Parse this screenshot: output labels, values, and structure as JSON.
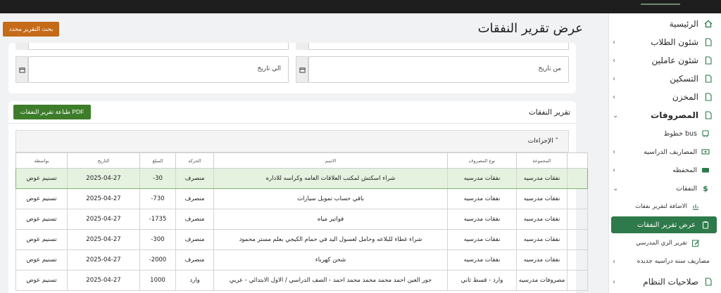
{
  "header": {
    "page_title": "عرض تقرير النفقات",
    "search_button": "بحث التقرير محدد"
  },
  "filters": {
    "from_date_label": "من تاريخ",
    "to_date_label": "الي تاريخ"
  },
  "report": {
    "title": "تقرير النفقات",
    "print_button": "طباعة تقرير النفقات PDF",
    "actions_label": "الإجراءات ˅"
  },
  "table": {
    "headers": [
      "بواسطه",
      "التاريخ",
      "المبلغ",
      "الحركه",
      "الاسم",
      "نوع المصروف",
      "المجموعة",
      ""
    ],
    "rows": [
      [
        "تسنيم عوض",
        "2025-04-27",
        "-30",
        "منصرف",
        "شراء اسكتش لمكتب العلاقات العامه وكراسه للاداره",
        "نفقات مدرسيه",
        "نفقات مدرسيه",
        ""
      ],
      [
        "تسنيم عوض",
        "2025-04-27",
        "-730",
        "منصرف",
        "باقي حساب تمويل سيارات",
        "نفقات مدرسيه",
        "نفقات مدرسيه",
        ""
      ],
      [
        "تسنيم عوض",
        "2025-04-27",
        "-1735",
        "منصرف",
        "فواتير مياه",
        "نفقات مدرسيه",
        "نفقات مدرسيه",
        ""
      ],
      [
        "تسنيم عوض",
        "2025-04-27",
        "-300",
        "منصرف",
        "شراء غطاء للبلاعه وحامل لغسول اليد في حمام الكيجي بعلم مستر محمود",
        "نفقات مدرسيه",
        "نفقات مدرسيه",
        ""
      ],
      [
        "تسنيم عوض",
        "2025-04-27",
        "-2000",
        "منصرف",
        "شحن كهرباء",
        "نفقات مدرسيه",
        "نفقات مدرسيه",
        ""
      ],
      [
        "تسنيم عوض",
        "2025-04-27",
        "1000",
        "وارد",
        "جور العين احمد محمد محمد محمد احمد - الصف الدراسي / الاول الابتدائي - عربي",
        "وارد - قسط ثاني",
        "مصروفات مدرسيه",
        ""
      ]
    ]
  },
  "sidebar": {
    "items": [
      {
        "label": "الرئيسية",
        "icon": "home-icon"
      },
      {
        "label": "شئون الطلاب",
        "icon": "file-icon"
      },
      {
        "label": "شئون عاملين",
        "icon": "file-icon"
      },
      {
        "label": "التسكين",
        "icon": "file-icon"
      },
      {
        "label": "المخزن",
        "icon": "file-icon"
      },
      {
        "label": "المصروفات",
        "icon": "file-icon"
      }
    ],
    "sub_items": [
      {
        "label": "خطوط bus",
        "icon": "bus-icon"
      },
      {
        "label": "المصاريف الدراسيه",
        "icon": "money-icon"
      },
      {
        "label": "المحفظه",
        "icon": "wallet-icon"
      },
      {
        "label": "النفقات",
        "icon": "dollar-icon"
      },
      {
        "label": "الاضافة لتقرير نفقات",
        "icon": "report-icon"
      },
      {
        "label": "عرض تقرير النفقات",
        "icon": "clipboard-icon"
      },
      {
        "label": "تقرير الزي المدرسي",
        "icon": "edit-icon"
      },
      {
        "label": "مصاريف سنه دراسيه جديده",
        "icon": "file-icon"
      },
      {
        "label": "صلاحيات النظام",
        "icon": "file-icon"
      }
    ]
  },
  "colors": {
    "accent_green": "#2e7a4a",
    "orange_button": "#c46a18",
    "print_button": "#3d7d2a",
    "selected_row": "#e6f2e0"
  }
}
